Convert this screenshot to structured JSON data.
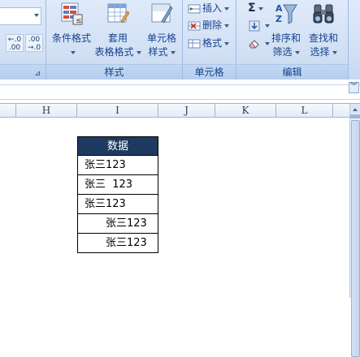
{
  "ribbon": {
    "number_group": {
      "dec_increase": "←.0\n.00",
      "dec_decrease": ".00\n→.0"
    },
    "styles_group": {
      "label": "样式",
      "buttons": [
        {
          "line1": "条件格式",
          "line2": ""
        },
        {
          "line1": "套用",
          "line2": "表格格式"
        },
        {
          "line1": "单元格",
          "line2": "样式"
        }
      ]
    },
    "cells_group": {
      "label": "单元格",
      "insert": "插入",
      "delete": "删除",
      "format": "格式"
    },
    "editing_group": {
      "label": "编辑",
      "sort_filter": {
        "line1": "排序和",
        "line2": "筛选"
      },
      "find_select": {
        "line1": "查找和",
        "line2": "选择"
      }
    }
  },
  "columns": [
    "H",
    "I",
    "J",
    "K",
    "L"
  ],
  "table": {
    "header": "数据",
    "rows": [
      "张三123",
      "张三  123",
      "张三123",
      "张三123",
      "张三123"
    ]
  },
  "icons": {
    "collapse_ribbon": "double-chevron-down-icon",
    "sum": "sigma-icon"
  }
}
